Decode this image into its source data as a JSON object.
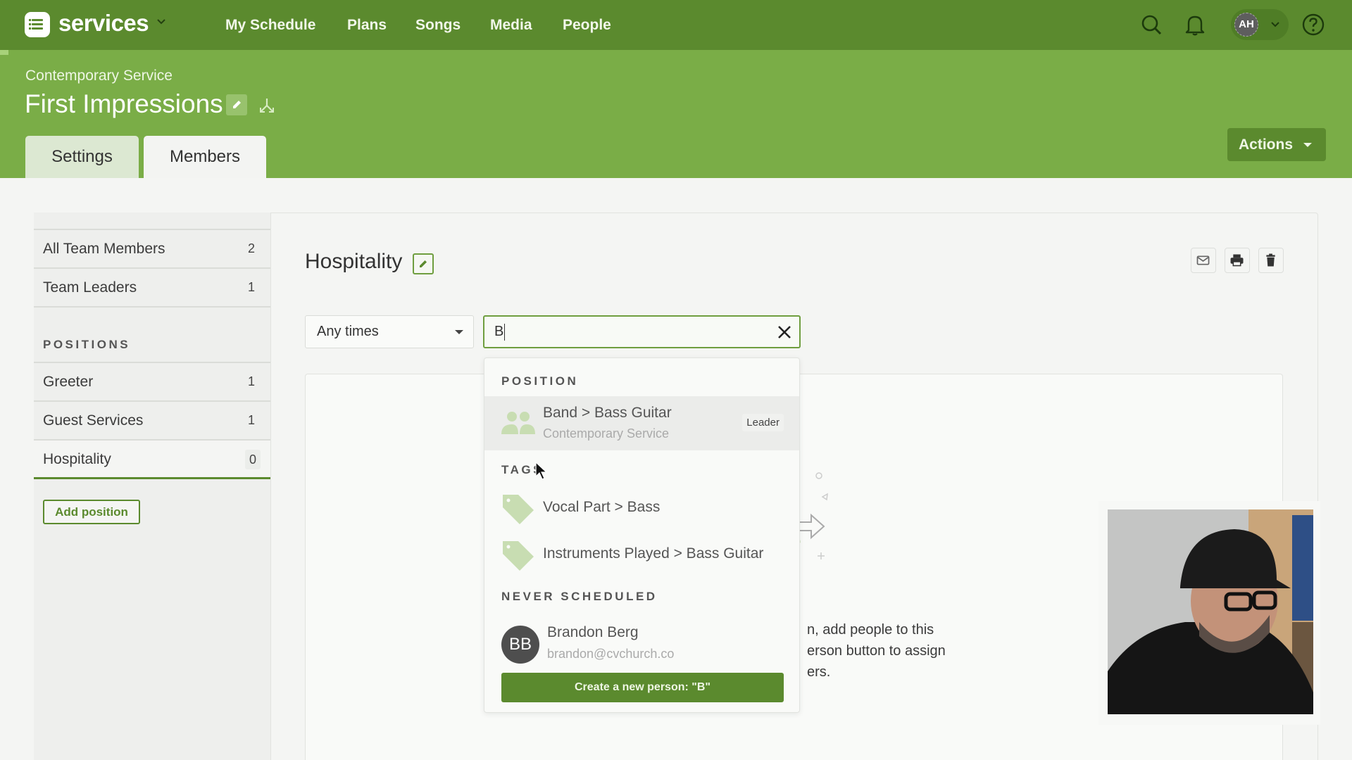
{
  "topnav": {
    "brand": "services",
    "links": [
      "My Schedule",
      "Plans",
      "Songs",
      "Media",
      "People"
    ],
    "user_initials": "AH",
    "icons": [
      "search-icon",
      "bell-icon",
      "chevron-down-icon",
      "help-icon"
    ]
  },
  "header": {
    "breadcrumb": "Contemporary Service",
    "title": "First Impressions",
    "tabs": [
      {
        "label": "Settings",
        "active": false
      },
      {
        "label": "Members",
        "active": true
      }
    ],
    "actions_label": "Actions"
  },
  "sidebar": {
    "items": [
      {
        "label": "All Team Members",
        "count": "2"
      },
      {
        "label": "Team Leaders",
        "count": "1"
      }
    ],
    "section_label": "POSITIONS",
    "positions": [
      {
        "label": "Greeter",
        "count": "1"
      },
      {
        "label": "Guest Services",
        "count": "1"
      },
      {
        "label": "Hospitality",
        "count": "0",
        "active": true
      }
    ],
    "add_position_label": "Add position"
  },
  "main": {
    "title": "Hospitality",
    "filter": {
      "selected": "Any times"
    },
    "search": {
      "value": "B"
    },
    "empty_state": {
      "lines": [
        "n, add people to this",
        "erson button to assign",
        "ers."
      ]
    }
  },
  "dropdown": {
    "position_header": "POSITION",
    "position": {
      "title": "Band > Bass Guitar",
      "subtitle": "Contemporary Service",
      "badge": "Leader"
    },
    "tags_header": "TAGS",
    "tags": [
      "Vocal Part > Bass",
      "Instruments Played > Bass Guitar"
    ],
    "never_scheduled_header": "NEVER SCHEDULED",
    "person": {
      "initials": "BB",
      "name": "Brandon Berg",
      "email": "brandon@cvchurch.co"
    },
    "create_label": "Create a new person: \"B\""
  },
  "colors": {
    "nav_green": "#5b8a2e",
    "header_green": "#7aad47",
    "tag_green": "#c8ddb2"
  }
}
